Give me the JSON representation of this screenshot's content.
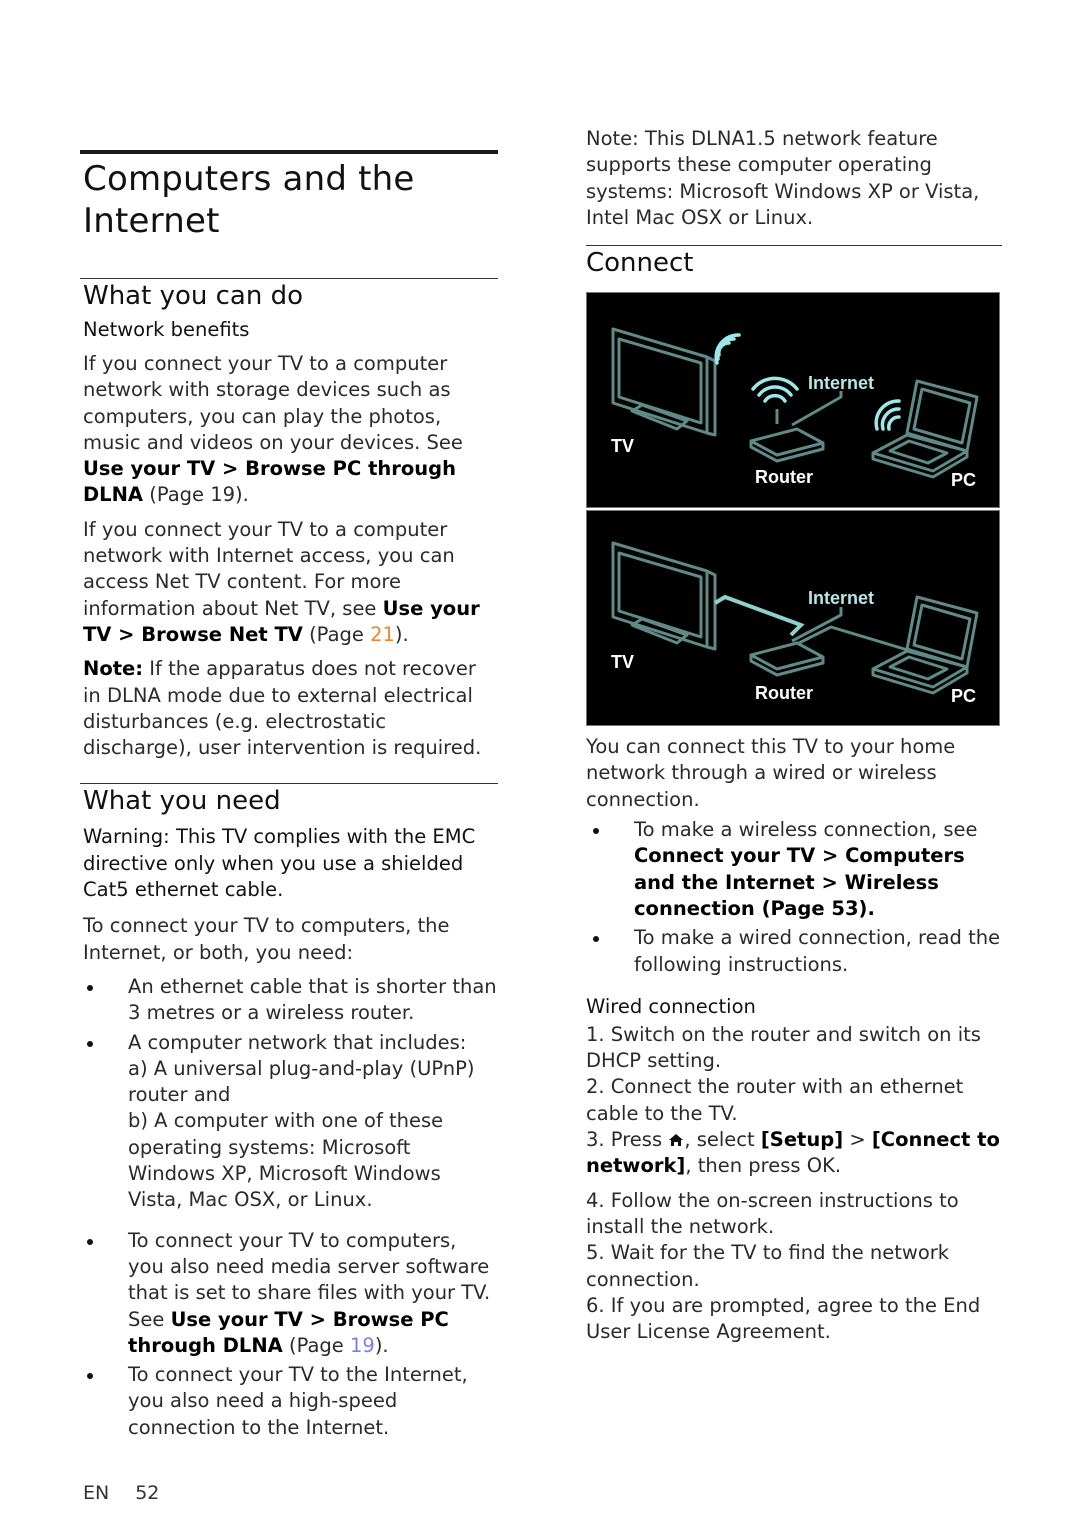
{
  "left": {
    "title_line1": "Computers and the",
    "title_line2": "Internet",
    "section1": {
      "heading": "What you can do",
      "subheading": "Network benefits",
      "para1": {
        "text": "If you connect your TV to a computer network with storage devices such as computers, you can play the photos, music and videos on your devices. See ",
        "link": "Use your TV > Browse PC through DLNA",
        "suffix": " (Page 19)."
      },
      "para2": {
        "text": "If you connect your TV to a computer network with Internet access, you can access Net TV content. For more information about Net TV, see ",
        "link": "Use your TV > Browse Net TV",
        "page_prefix": " (Page ",
        "page": "21",
        "page_suffix": ")."
      },
      "note": {
        "label": "Note:",
        "text": " If the apparatus does not recover in DLNA mode due to external electrical disturbances (e.g. electrostatic discharge), user intervention is required."
      }
    },
    "section2": {
      "heading": "What you need",
      "warning": "Warning: This TV complies with the EMC directive only when you use a shielded Cat5 ethernet cable.",
      "intro": "To connect your TV to computers, the Internet, or both, you need:",
      "bullets": [
        {
          "text": "An ethernet cable that is shorter than 3 metres or a wireless router."
        },
        {
          "text": "A computer network that includes:",
          "sub_a": "a) A universal plug-and-play (UPnP) router and",
          "sub_b": "b) A computer with one of these operating systems: Microsoft Windows XP, Microsoft Windows Vista, Mac OSX, or Linux."
        }
      ],
      "bullets2": [
        {
          "text": "To connect your TV to computers, you also need media server software that is set to share files with your TV. See ",
          "link": "Use your TV > Browse PC through DLNA",
          "page_prefix": " (Page ",
          "page": "19",
          "page_suffix": ")."
        },
        {
          "text": "To connect your TV to the Internet, you also need a high-speed connection to the Internet."
        }
      ]
    }
  },
  "right": {
    "note": "Note: This DLNA1.5 network feature supports these computer operating systems: Microsoft Windows XP or Vista, Intel Mac OSX or Linux.",
    "heading": "Connect",
    "diagram_wireless": {
      "tv": "TV",
      "router": "Router",
      "internet": "Internet",
      "pc": "PC"
    },
    "diagram_wired": {
      "tv": "TV",
      "router": "Router",
      "internet": "Internet",
      "pc": "PC"
    },
    "intro": "You can connect this TV to your home network through a wired or wireless connection.",
    "bullets": [
      {
        "text": "To make a wireless connection, see ",
        "link": "Connect your TV > Computers and the Internet > Wireless connection (Page 53)."
      },
      {
        "text": "To make a wired connection, read the following instructions."
      }
    ],
    "wired": {
      "heading": "Wired connection",
      "step1": "1. Switch on the router and switch on its DHCP setting.",
      "step2": "2. Connect the router with an ethernet cable to the TV.",
      "step3_a": "3. Press ",
      "step3_b": ", select ",
      "step3_setup": "[Setup]",
      "step3_gt": " > ",
      "step3_connect": "[Connect to network]",
      "step3_c": ", then press OK.",
      "step4": "4. Follow the on-screen instructions to install the network.",
      "step5": "5. Wait for the TV to find the network connection.",
      "step6": "6. If you are prompted, agree to the End User License Agreement."
    }
  },
  "footer": {
    "lang": "EN",
    "page": "52"
  },
  "colors": {
    "link_orange": "#e8892c",
    "link_blue": "#7b7fe0",
    "diagram_line": "#5f8a88",
    "diagram_wifi": "#9fe6ea"
  }
}
